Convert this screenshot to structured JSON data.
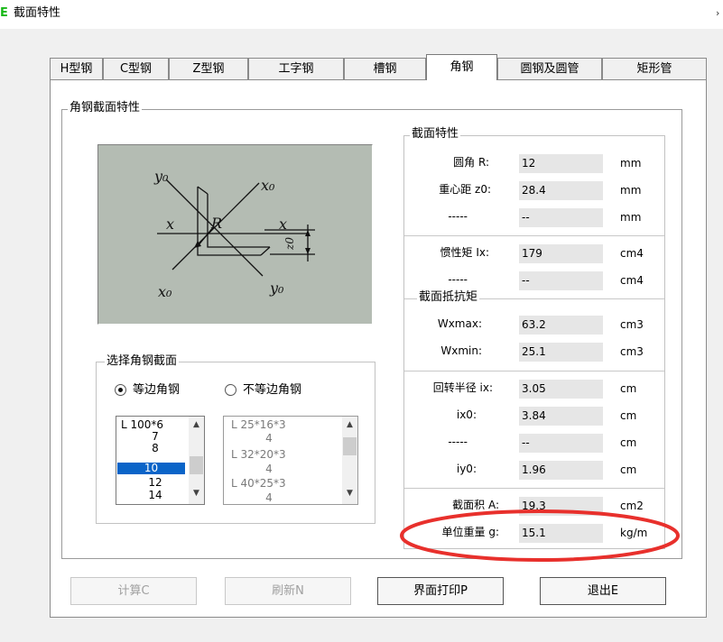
{
  "window": {
    "title": "截面特性",
    "close_glyph": "›"
  },
  "tabs": [
    {
      "label": "H型钢"
    },
    {
      "label": "C型钢"
    },
    {
      "label": "Z型钢"
    },
    {
      "label": "工字钢"
    },
    {
      "label": "槽钢"
    },
    {
      "label": "角钢",
      "active": true
    },
    {
      "label": "圆钢及圆管"
    },
    {
      "label": "矩形管"
    }
  ],
  "section_group": {
    "label": "角钢截面特性"
  },
  "diagram": {
    "label_y0_top": "y₀",
    "label_x0_top": "x₀",
    "label_x_left": "x",
    "label_R": "R",
    "label_x_right": "x",
    "label_z0": "z0",
    "label_x0_bottom": "x₀",
    "label_y0_bottom": "y₀"
  },
  "select_group": {
    "label": "选择角钢截面",
    "radio_equal": {
      "label": "等边角钢",
      "checked": true
    },
    "radio_unequal": {
      "label": "不等边角钢",
      "checked": false
    },
    "equal_list": [
      "L 100*6",
      "7",
      "8",
      "10",
      "12",
      "14"
    ],
    "equal_selected": "10",
    "unequal_list": [
      "L 25*16*3",
      "4",
      "L 32*20*3",
      "4",
      "L 40*25*3",
      "4"
    ]
  },
  "properties": {
    "label": "截面特性",
    "resist_label": "截面抵抗矩",
    "rows": [
      {
        "label": "圆角   R:",
        "value": "12",
        "unit": "mm"
      },
      {
        "label": "重心距 z0:",
        "value": "28.4",
        "unit": "mm"
      },
      {
        "label": "-----",
        "value": "--",
        "unit": "mm"
      },
      {
        "label": "惯性矩 Ix:",
        "value": "179",
        "unit": "cm4"
      },
      {
        "label": "-----",
        "value": "--",
        "unit": "cm4"
      },
      {
        "label": "Wxmax:",
        "value": "63.2",
        "unit": "cm3"
      },
      {
        "label": "Wxmin:",
        "value": "25.1",
        "unit": "cm3"
      },
      {
        "label": "回转半径 ix:",
        "value": "3.05",
        "unit": "cm"
      },
      {
        "label": "ix0:",
        "value": "3.84",
        "unit": "cm"
      },
      {
        "label": "-----",
        "value": "--",
        "unit": "cm"
      },
      {
        "label": "iy0:",
        "value": "1.96",
        "unit": "cm"
      },
      {
        "label": "截面积 A:",
        "value": "19.3",
        "unit": "cm2"
      },
      {
        "label": "单位重量 g:",
        "value": "15.1",
        "unit": "kg/m"
      }
    ]
  },
  "buttons": [
    {
      "label": "计算C",
      "enabled": false
    },
    {
      "label": "刷新N",
      "enabled": false
    },
    {
      "label": "界面打印P",
      "enabled": true
    },
    {
      "label": "退出E",
      "enabled": true
    }
  ],
  "colors": {
    "highlight_ellipse": "#e8302c",
    "list_selection": "#0a64c8",
    "diagram_bg": "#b4bcb3"
  }
}
